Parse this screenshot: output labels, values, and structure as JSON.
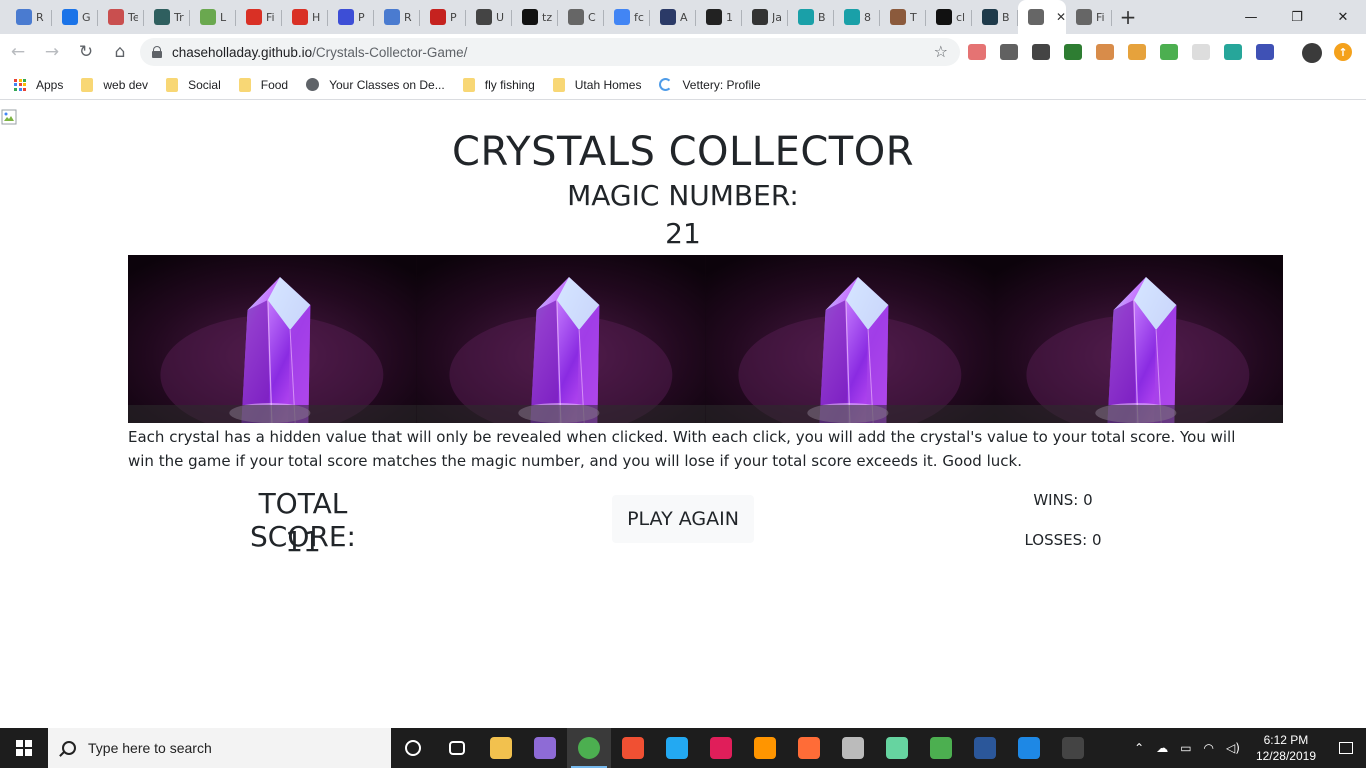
{
  "browser": {
    "tabs": [
      {
        "char": "R",
        "color": "#4a7bd0"
      },
      {
        "char": "G",
        "color": "#1a73e8"
      },
      {
        "char": "Te",
        "color": "#c94f4f"
      },
      {
        "char": "Tr",
        "color": "#2f5f5f"
      },
      {
        "char": "L",
        "color": "#6aa84f"
      },
      {
        "char": "Fi",
        "color": "#d93025"
      },
      {
        "char": "H",
        "color": "#d93025"
      },
      {
        "char": "P",
        "color": "#3d4ed6"
      },
      {
        "char": "R",
        "color": "#4a7bd0"
      },
      {
        "char": "P",
        "color": "#c5221f"
      },
      {
        "char": "U",
        "color": "#444444"
      },
      {
        "char": "tz",
        "color": "#111111"
      },
      {
        "char": "C",
        "color": "#666666"
      },
      {
        "char": "fc",
        "color": "#4285f4"
      },
      {
        "char": "A",
        "color": "#2b3a67"
      },
      {
        "char": "1",
        "color": "#222222"
      },
      {
        "char": "Ja",
        "color": "#333333"
      },
      {
        "char": "B",
        "color": "#1aa0a8"
      },
      {
        "char": "8",
        "color": "#1aa0a8"
      },
      {
        "char": "T",
        "color": "#8b5a3c"
      },
      {
        "char": "cl",
        "color": "#111111"
      },
      {
        "char": "B",
        "color": "#1e3a4a"
      },
      {
        "char": "",
        "color": "#666666",
        "active": true
      },
      {
        "char": "Fi",
        "color": "#666666"
      }
    ],
    "new_tab": "+",
    "window": {
      "minimize": "—",
      "restore": "❐",
      "close": "✕"
    },
    "url_host": "chaseholladay.github.io",
    "url_path": "/Crystals-Collector-Game/",
    "bookmarks": [
      {
        "label": "Apps",
        "type": "apps"
      },
      {
        "label": "web dev",
        "type": "folder"
      },
      {
        "label": "Social",
        "type": "folder"
      },
      {
        "label": "Food",
        "type": "folder"
      },
      {
        "label": "Your Classes on De...",
        "type": "globe"
      },
      {
        "label": "fly fishing",
        "type": "folder"
      },
      {
        "label": "Utah Homes",
        "type": "folder"
      },
      {
        "label": "Vettery: Profile",
        "type": "vettery"
      }
    ],
    "extension_colors": [
      "#e57373",
      "#616161",
      "#444444",
      "#2e7d32",
      "#d88c4a",
      "#e6a23c",
      "#4caf50",
      "#dddddd",
      "#26a69a",
      "#3f51b5"
    ]
  },
  "game": {
    "title": "CRYSTALS COLLECTOR",
    "magic_label": "MAGIC NUMBER:",
    "magic_value": "21",
    "crystal_count": 4,
    "instructions": "Each crystal has a hidden value that will only be revealed when clicked. With each click, you will add the crystal's value to your total score. You will win the game if your total score matches the magic number, and you will lose if your total score exceeds it. Good luck.",
    "score_label": "TOTAL SCORE:",
    "score_value": "11",
    "play_again": "PLAY AGAIN",
    "wins": "WINS: 0",
    "losses": "LOSSES: 0"
  },
  "taskbar": {
    "search_placeholder": "Type here to search",
    "apps": [
      {
        "name": "task-view",
        "color": "#ffffff"
      },
      {
        "name": "file-explorer",
        "color": "#f2c14e"
      },
      {
        "name": "app-purple",
        "color": "#8e6bd6"
      },
      {
        "name": "chrome",
        "color": "#4caf50",
        "active": true
      },
      {
        "name": "git",
        "color": "#f05033"
      },
      {
        "name": "vscode",
        "color": "#23a9f2"
      },
      {
        "name": "slack",
        "color": "#e01e5a"
      },
      {
        "name": "firefox",
        "color": "#ff9500"
      },
      {
        "name": "postman",
        "color": "#ff6c37"
      },
      {
        "name": "app-gray",
        "color": "#bbbbbb"
      },
      {
        "name": "app-atom",
        "color": "#66d4a0"
      },
      {
        "name": "app-green",
        "color": "#4caf50"
      },
      {
        "name": "word",
        "color": "#2b579a"
      },
      {
        "name": "edge",
        "color": "#1e88e5"
      },
      {
        "name": "terminal",
        "color": "#444444"
      }
    ],
    "time": "6:12 PM",
    "date": "12/28/2019"
  }
}
